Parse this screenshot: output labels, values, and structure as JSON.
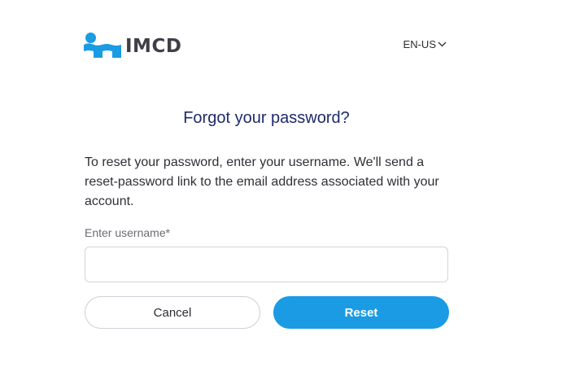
{
  "header": {
    "logo_text": "IMCD",
    "language": "EN-US"
  },
  "main": {
    "title": "Forgot your password?",
    "description": "To reset your password, enter your username. We'll send a reset-password link to the email address associated with your account.",
    "username": {
      "label": "Enter username",
      "required_marker": "*",
      "value": "",
      "placeholder": ""
    },
    "cancel_label": "Cancel",
    "reset_label": "Reset"
  },
  "colors": {
    "brand_blue": "#1a9be3",
    "title_navy": "#1f2a6b"
  }
}
